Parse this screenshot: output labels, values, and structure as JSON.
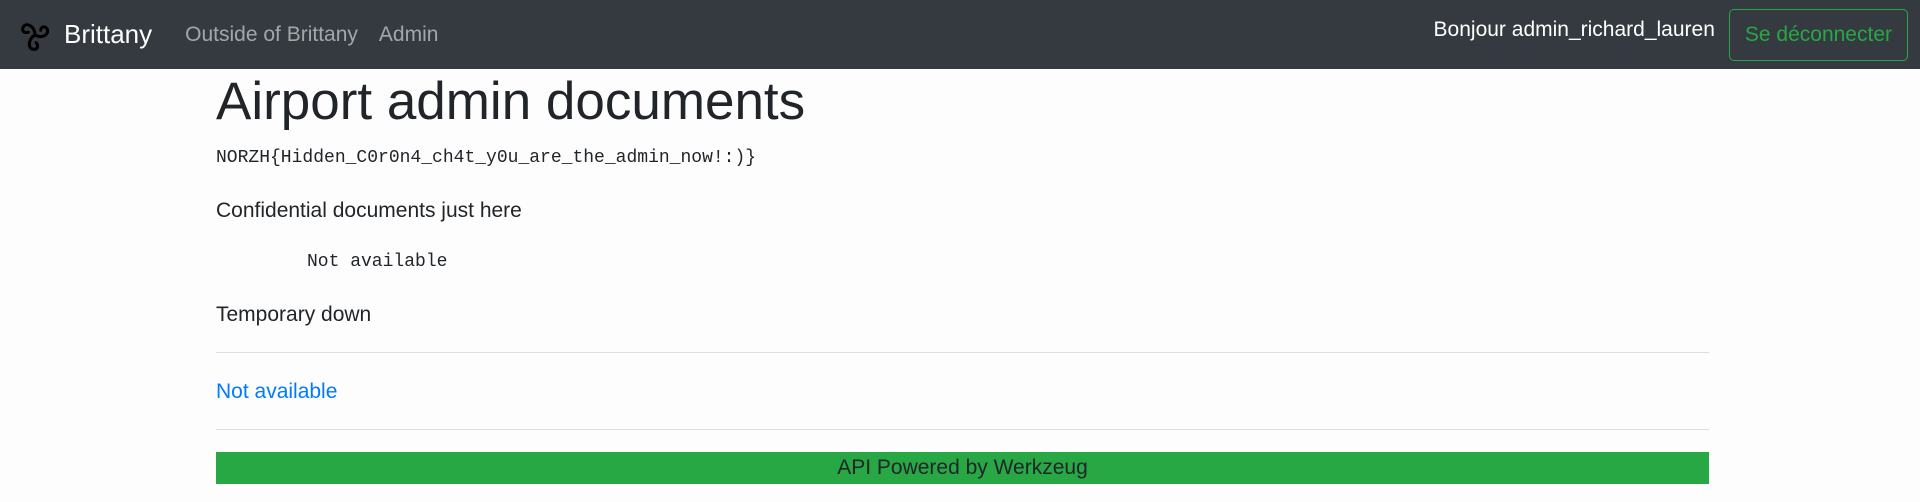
{
  "navbar": {
    "brand_icon": "triskelion-icon",
    "brand_name": "Brittany",
    "links": [
      "Outside of Brittany",
      "Admin"
    ],
    "greeting": "Bonjour admin_richard_lauren",
    "logout_label": "Se déconnecter"
  },
  "main": {
    "title": "Airport admin documents",
    "flag": "NORZH{Hidden_C0r0n4_ch4t_y0u_are_the_admin_now!:)}",
    "section1_title": "Confidential documents just here",
    "section1_value": "Not available",
    "section2_title": "Temporary down",
    "link_text": "Not available"
  },
  "footer": {
    "text": "API Powered by Werkzeug"
  },
  "colors": {
    "navbar_bg": "#343a40",
    "accent_green": "#28a745",
    "link_blue": "#007bff"
  }
}
